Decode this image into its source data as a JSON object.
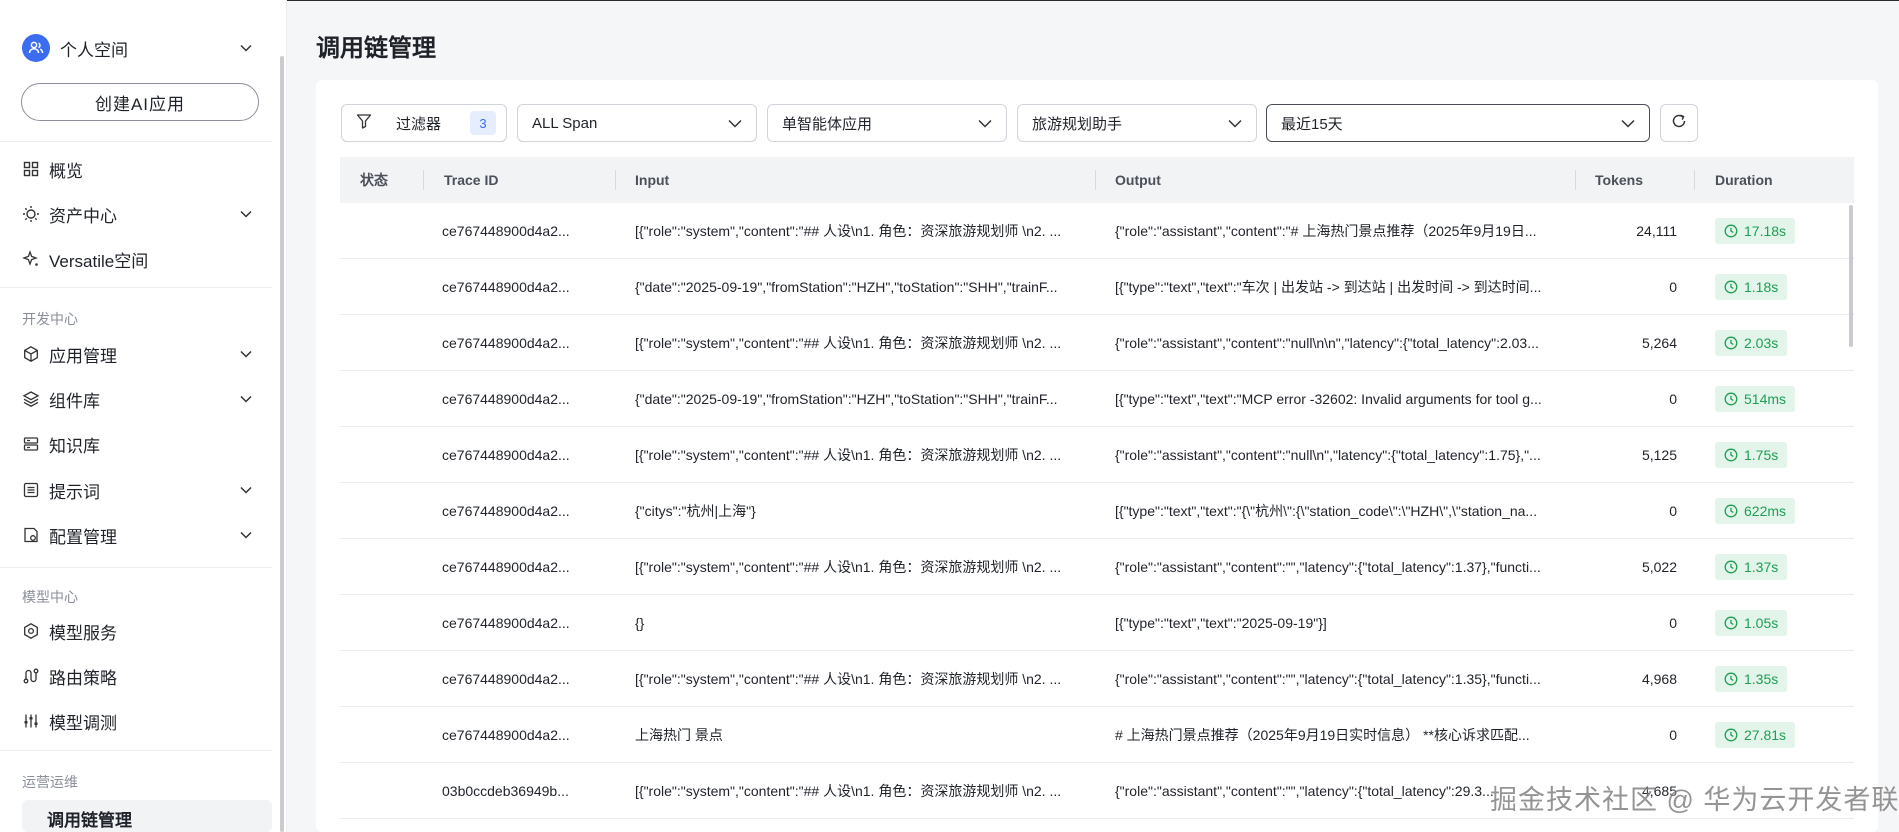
{
  "sidebar": {
    "space": "个人空间",
    "create_button": "创建AI应用",
    "items_top": [
      {
        "label": "概览",
        "icon": "overview-icon",
        "expandable": false
      },
      {
        "label": "资产中心",
        "icon": "asset-icon",
        "expandable": true
      },
      {
        "label": "Versatile空间",
        "icon": "sparkle-icon",
        "expandable": false
      }
    ],
    "section_dev": "开发中心",
    "items_dev": [
      {
        "label": "应用管理",
        "icon": "cube-icon",
        "expandable": true
      },
      {
        "label": "组件库",
        "icon": "layers-icon",
        "expandable": true
      },
      {
        "label": "知识库",
        "icon": "database-icon",
        "expandable": false
      },
      {
        "label": "提示词",
        "icon": "list-icon",
        "expandable": true
      },
      {
        "label": "配置管理",
        "icon": "config-icon",
        "expandable": true
      }
    ],
    "section_model": "模型中心",
    "items_model": [
      {
        "label": "模型服务",
        "icon": "hexagon-icon",
        "expandable": false
      },
      {
        "label": "路由策略",
        "icon": "route-icon",
        "expandable": false
      },
      {
        "label": "模型调测",
        "icon": "sliders-icon",
        "expandable": false
      }
    ],
    "section_ops": "运营运维",
    "active_item": "调用链管理"
  },
  "page": {
    "title": "调用链管理"
  },
  "toolbar": {
    "filter_label": "过滤器",
    "filter_count": "3",
    "span_select": "ALL Span",
    "app_type_select": "单智能体应用",
    "app_select": "旅游规划助手",
    "time_select": "最近15天"
  },
  "table": {
    "headers": {
      "status": "状态",
      "trace_id": "Trace ID",
      "input": "Input",
      "output": "Output",
      "tokens": "Tokens",
      "duration": "Duration"
    },
    "rows": [
      {
        "status": "",
        "trace_id": "ce767448900d4a2...",
        "input": "[{\"role\":\"system\",\"content\":\"## 人设\\n1. 角色：资深旅游规划师 \\n2. ...",
        "output": "{\"role\":\"assistant\",\"content\":\"# 上海热门景点推荐（2025年9月19日...",
        "tokens": "24,111",
        "duration": "17.18s"
      },
      {
        "status": "",
        "trace_id": "ce767448900d4a2...",
        "input": "{\"date\":\"2025-09-19\",\"fromStation\":\"HZH\",\"toStation\":\"SHH\",\"trainF...",
        "output": "[{\"type\":\"text\",\"text\":\"车次 | 出发站 -> 到达站 | 出发时间 -> 到达时间...",
        "tokens": "0",
        "duration": "1.18s"
      },
      {
        "status": "",
        "trace_id": "ce767448900d4a2...",
        "input": "[{\"role\":\"system\",\"content\":\"## 人设\\n1. 角色：资深旅游规划师 \\n2. ...",
        "output": "{\"role\":\"assistant\",\"content\":\"null\\n\\n\",\"latency\":{\"total_latency\":2.03...",
        "tokens": "5,264",
        "duration": "2.03s"
      },
      {
        "status": "",
        "trace_id": "ce767448900d4a2...",
        "input": "{\"date\":\"2025-09-19\",\"fromStation\":\"HZH\",\"toStation\":\"SHH\",\"trainF...",
        "output": "[{\"type\":\"text\",\"text\":\"MCP error -32602: Invalid arguments for tool g...",
        "tokens": "0",
        "duration": "514ms"
      },
      {
        "status": "",
        "trace_id": "ce767448900d4a2...",
        "input": "[{\"role\":\"system\",\"content\":\"## 人设\\n1. 角色：资深旅游规划师 \\n2. ...",
        "output": "{\"role\":\"assistant\",\"content\":\"null\\n\",\"latency\":{\"total_latency\":1.75},\"...",
        "tokens": "5,125",
        "duration": "1.75s"
      },
      {
        "status": "",
        "trace_id": "ce767448900d4a2...",
        "input": "{\"citys\":\"杭州|上海\"}",
        "output": "[{\"type\":\"text\",\"text\":\"{\\\"杭州\\\":{\\\"station_code\\\":\\\"HZH\\\",\\\"station_na...",
        "tokens": "0",
        "duration": "622ms"
      },
      {
        "status": "",
        "trace_id": "ce767448900d4a2...",
        "input": "[{\"role\":\"system\",\"content\":\"## 人设\\n1. 角色：资深旅游规划师 \\n2. ...",
        "output": "{\"role\":\"assistant\",\"content\":\"\",\"latency\":{\"total_latency\":1.37},\"functi...",
        "tokens": "5,022",
        "duration": "1.37s"
      },
      {
        "status": "",
        "trace_id": "ce767448900d4a2...",
        "input": "{}",
        "output": "[{\"type\":\"text\",\"text\":\"2025-09-19\"}]",
        "tokens": "0",
        "duration": "1.05s"
      },
      {
        "status": "",
        "trace_id": "ce767448900d4a2...",
        "input": "[{\"role\":\"system\",\"content\":\"## 人设\\n1. 角色：资深旅游规划师 \\n2. ...",
        "output": "{\"role\":\"assistant\",\"content\":\"\",\"latency\":{\"total_latency\":1.35},\"functi...",
        "tokens": "4,968",
        "duration": "1.35s"
      },
      {
        "status": "",
        "trace_id": "ce767448900d4a2...",
        "input": "上海热门 景点",
        "output": "# 上海热门景点推荐（2025年9月19日实时信息） **核心诉求匹配...",
        "tokens": "0",
        "duration": "27.81s"
      },
      {
        "status": "",
        "trace_id": "03b0ccdeb36949b...",
        "input": "[{\"role\":\"system\",\"content\":\"## 人设\\n1. 角色：资深旅游规划师 \\n2. ...",
        "output": "{\"role\":\"assistant\",\"content\":\"\",\"latency\":{\"total_latency\":29.3...",
        "tokens": "4,685",
        "duration": ""
      }
    ]
  },
  "watermark": "掘金技术社区 @ 华为云开发者联盟",
  "colors": {
    "accent": "#3b6df0",
    "duration_bg": "#e3f5ea",
    "duration_fg": "#1f9d55"
  }
}
